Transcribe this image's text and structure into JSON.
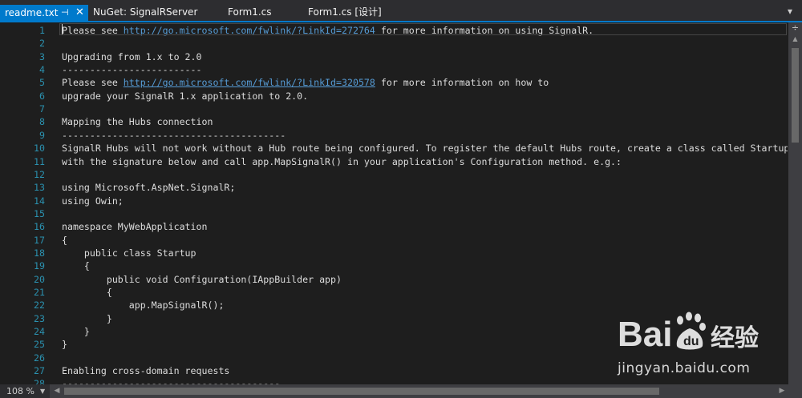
{
  "tabs": [
    {
      "label": "readme.txt",
      "active": true
    },
    {
      "label": "NuGet: SignalRServer",
      "active": false
    },
    {
      "label": "Form1.cs",
      "active": false
    },
    {
      "label": "Form1.cs [设计]",
      "active": false
    }
  ],
  "tab_icons": {
    "pin": "pin-icon",
    "close": "close-icon",
    "dropdown": "dropdown-arrow-icon"
  },
  "editor": {
    "lines": [
      {
        "num": "1",
        "parts": [
          {
            "t": "Please see "
          },
          {
            "t": "http://go.microsoft.com/fwlink/?LinkId=272764",
            "link": true
          },
          {
            "t": " for more information on using SignalR."
          }
        ]
      },
      {
        "num": "2",
        "parts": []
      },
      {
        "num": "3",
        "parts": [
          {
            "t": "Upgrading from 1.x to 2.0"
          }
        ]
      },
      {
        "num": "4",
        "parts": [
          {
            "t": "-------------------------"
          }
        ]
      },
      {
        "num": "5",
        "parts": [
          {
            "t": "Please see "
          },
          {
            "t": "http://go.microsoft.com/fwlink/?LinkId=320578",
            "link": true
          },
          {
            "t": " for more information on how to"
          }
        ]
      },
      {
        "num": "6",
        "parts": [
          {
            "t": "upgrade your SignalR 1.x application to 2.0."
          }
        ]
      },
      {
        "num": "7",
        "parts": []
      },
      {
        "num": "8",
        "parts": [
          {
            "t": "Mapping the Hubs connection"
          }
        ]
      },
      {
        "num": "9",
        "parts": [
          {
            "t": "----------------------------------------"
          }
        ]
      },
      {
        "num": "10",
        "parts": [
          {
            "t": "SignalR Hubs will not work without a Hub route being configured. To register the default Hubs route, create a class called Startup"
          }
        ]
      },
      {
        "num": "11",
        "parts": [
          {
            "t": "with the signature below and call app.MapSignalR() in your application's Configuration method. e.g.:"
          }
        ]
      },
      {
        "num": "12",
        "parts": []
      },
      {
        "num": "13",
        "parts": [
          {
            "t": "using Microsoft.AspNet.SignalR;"
          }
        ]
      },
      {
        "num": "14",
        "parts": [
          {
            "t": "using Owin;"
          }
        ]
      },
      {
        "num": "15",
        "parts": []
      },
      {
        "num": "16",
        "parts": [
          {
            "t": "namespace MyWebApplication"
          }
        ]
      },
      {
        "num": "17",
        "parts": [
          {
            "t": "{"
          }
        ]
      },
      {
        "num": "18",
        "parts": [
          {
            "t": "    public class Startup"
          }
        ]
      },
      {
        "num": "19",
        "parts": [
          {
            "t": "    {"
          }
        ]
      },
      {
        "num": "20",
        "parts": [
          {
            "t": "        public void Configuration(IAppBuilder app)"
          }
        ]
      },
      {
        "num": "21",
        "parts": [
          {
            "t": "        {"
          }
        ]
      },
      {
        "num": "22",
        "parts": [
          {
            "t": "            app.MapSignalR();"
          }
        ]
      },
      {
        "num": "23",
        "parts": [
          {
            "t": "        }"
          }
        ]
      },
      {
        "num": "24",
        "parts": [
          {
            "t": "    }"
          }
        ]
      },
      {
        "num": "25",
        "parts": [
          {
            "t": "}"
          }
        ]
      },
      {
        "num": "26",
        "parts": []
      },
      {
        "num": "27",
        "parts": [
          {
            "t": "Enabling cross-domain requests"
          }
        ]
      },
      {
        "num": "28",
        "parts": [
          {
            "t": "---------------------------------------"
          }
        ]
      }
    ]
  },
  "status": {
    "zoom": "108 %"
  },
  "scroll_icons": {
    "split": "split-icon",
    "up": "scroll-up-icon",
    "left": "scroll-left-icon",
    "right": "scroll-right-icon",
    "zoom_dropdown": "zoom-dropdown-icon"
  },
  "colors": {
    "accent": "#007acc",
    "link": "#569cd6",
    "line_number": "#2b91af",
    "text": "#dcdcdc",
    "background": "#1e1e1e"
  },
  "watermark": {
    "logo_text": "Bai百度 经验",
    "url": "jingyan.baidu.com"
  }
}
